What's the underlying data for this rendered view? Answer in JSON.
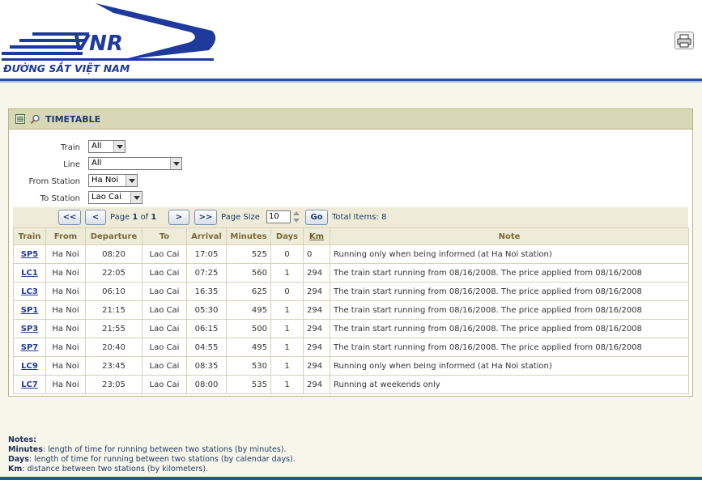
{
  "header": {
    "logo_text": "VNR",
    "logo_subtitle": "ĐƯỜNG SẮT VIỆT NAM",
    "print_icon": "print-icon"
  },
  "panel": {
    "title": "TIMETABLE",
    "icons": [
      "list-icon",
      "search-icon"
    ]
  },
  "filters": {
    "train": {
      "label": "Train",
      "value": "All"
    },
    "line": {
      "label": "Line",
      "value": "All"
    },
    "from_station": {
      "label": "From Station",
      "value": "Ha Noi"
    },
    "to_station": {
      "label": "To Station",
      "value": "Lao Cai"
    }
  },
  "pager": {
    "first": "<<",
    "prev": "<",
    "page_word": "Page",
    "page_current": "1",
    "of_word": "of",
    "page_total": "1",
    "next": ">",
    "last": ">>",
    "page_size_label": "Page Size",
    "page_size_value": "10",
    "go": "Go",
    "total_items": "Total Items: 8"
  },
  "table": {
    "columns": [
      "Train",
      "From",
      "Departure",
      "To",
      "Arrival",
      "Minutes",
      "Days",
      "Km",
      "Note"
    ],
    "rows": [
      {
        "train": "SP5",
        "from": "Ha Noi",
        "departure": "08:20",
        "to": "Lao Cai",
        "arrival": "17:05",
        "minutes": "525",
        "days": "0",
        "km": "0",
        "note": "Running only when being informed (at Ha Noi station)"
      },
      {
        "train": "LC1",
        "from": "Ha Noi",
        "departure": "22:05",
        "to": "Lao Cai",
        "arrival": "07:25",
        "minutes": "560",
        "days": "1",
        "km": "294",
        "note": "The train start running from 08/16/2008. The price applied from 08/16/2008"
      },
      {
        "train": "LC3",
        "from": "Ha Noi",
        "departure": "06:10",
        "to": "Lao Cai",
        "arrival": "16:35",
        "minutes": "625",
        "days": "0",
        "km": "294",
        "note": "The train start running from 08/16/2008. The price applied from 08/16/2008"
      },
      {
        "train": "SP1",
        "from": "Ha Noi",
        "departure": "21:15",
        "to": "Lao Cai",
        "arrival": "05:30",
        "minutes": "495",
        "days": "1",
        "km": "294",
        "note": "The train start running from 08/16/2008. The price applied from 08/16/2008"
      },
      {
        "train": "SP3",
        "from": "Ha Noi",
        "departure": "21:55",
        "to": "Lao Cai",
        "arrival": "06:15",
        "minutes": "500",
        "days": "1",
        "km": "294",
        "note": "The train start running from 08/16/2008. The price applied from 08/16/2008"
      },
      {
        "train": "SP7",
        "from": "Ha Noi",
        "departure": "20:40",
        "to": "Lao Cai",
        "arrival": "04:55",
        "minutes": "495",
        "days": "1",
        "km": "294",
        "note": "The train start running from 08/16/2008. The price applied from 08/16/2008"
      },
      {
        "train": "LC9",
        "from": "Ha Noi",
        "departure": "23:45",
        "to": "Lao Cai",
        "arrival": "08:35",
        "minutes": "530",
        "days": "1",
        "km": "294",
        "note": "Running only when being informed (at Ha Noi station)"
      },
      {
        "train": "LC7",
        "from": "Ha Noi",
        "departure": "23:05",
        "to": "Lao Cai",
        "arrival": "08:00",
        "minutes": "535",
        "days": "1",
        "km": "294",
        "note": "Running at weekends only"
      }
    ]
  },
  "notes": {
    "heading": "Notes:",
    "minutes_label": "Minutes",
    "minutes_text": ": length of time for running between two stations (by minutes).",
    "days_label": "Days",
    "days_text": ": length of time for running between two stations (by calendar days).",
    "km_label": "Km",
    "km_text": ": distance between two stations (by kilometers)."
  },
  "colors": {
    "brand_blue": "#1d3a9c",
    "header_bar": "#2b4fa3",
    "panel_header": "#d9d8b6",
    "link": "#1f3a9c"
  }
}
